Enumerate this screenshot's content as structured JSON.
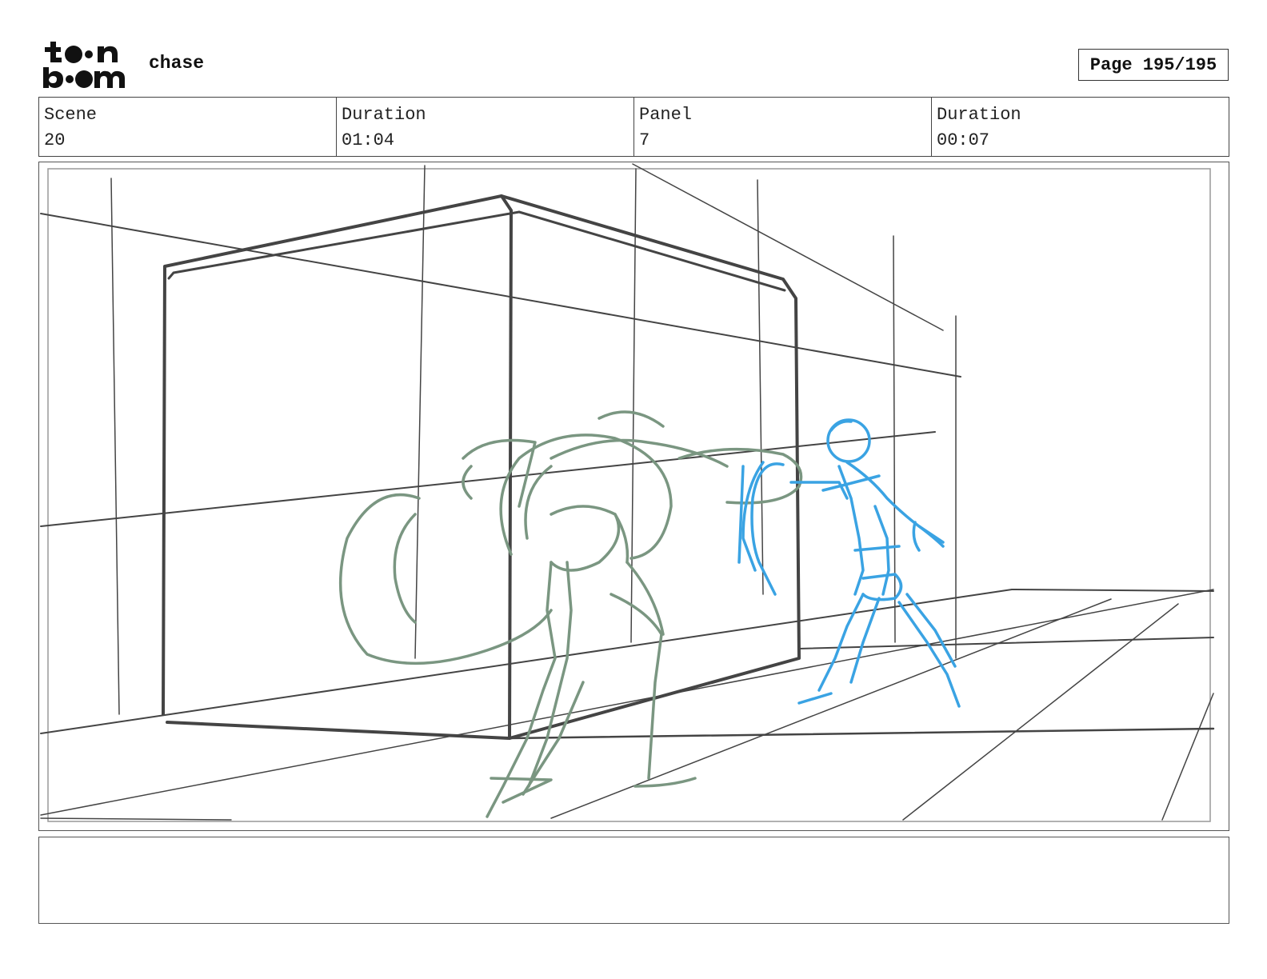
{
  "header": {
    "logo_text": "toon boom",
    "project_title": "chase",
    "page_label": "Page 195/195"
  },
  "info": {
    "scene_label": "Scene",
    "scene_value": "20",
    "scene_duration_label": "Duration",
    "scene_duration_value": "01:04",
    "panel_label": "Panel",
    "panel_value": "7",
    "panel_duration_label": "Duration",
    "panel_duration_value": "00:07"
  },
  "notes": {
    "text": ""
  },
  "colors": {
    "structure_lines": "#444444",
    "creature_sketch": "#7a9681",
    "character_sketch": "#3aa3e3"
  }
}
